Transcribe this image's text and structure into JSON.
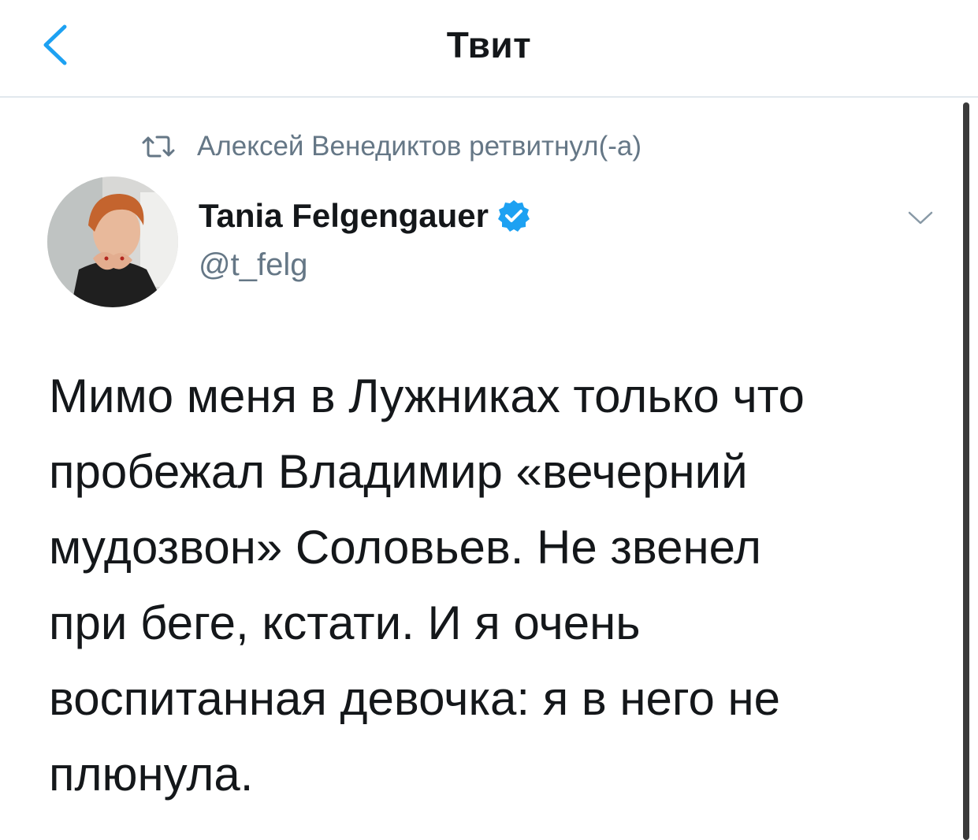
{
  "header": {
    "title": "Твит"
  },
  "retweet": {
    "text": "Алексей Венедиктов ретвитнул(-а)"
  },
  "author": {
    "name": "Tania Felgengauer",
    "handle": "@t_felg",
    "verified": true
  },
  "tweet": {
    "lines": [
      "Мимо меня в Лужниках только что",
      "пробежал Владимир «вечерний",
      "мудозвон» Соловьев. Не звенел",
      "при беге, кстати. И я очень",
      "воспитанная девочка: я в него не",
      "плюнула."
    ]
  },
  "icons": {
    "back": "chevron-left-icon",
    "retweet": "retweet-icon",
    "verified": "verified-badge-icon",
    "menu": "chevron-down-icon"
  },
  "colors": {
    "accent": "#1da1f2",
    "secondary_text": "#657786",
    "primary_text": "#14171a",
    "divider": "#e1e8ed"
  }
}
